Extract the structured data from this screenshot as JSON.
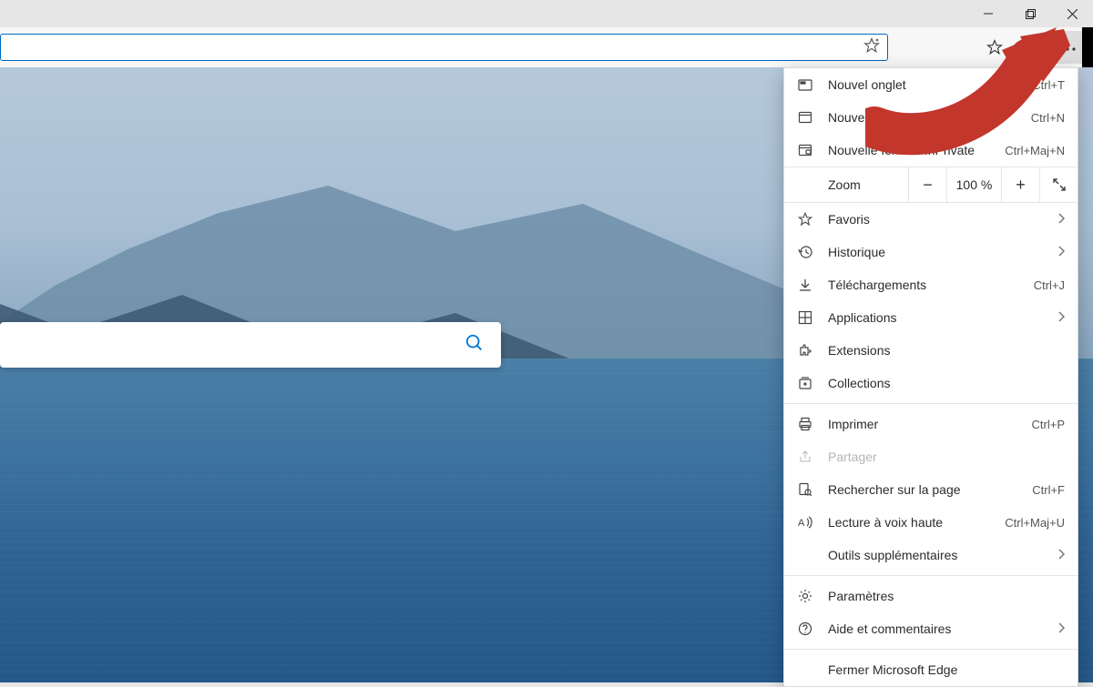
{
  "window_controls": {
    "minimize": "minimize",
    "maximize": "maximize",
    "close": "close"
  },
  "menu": {
    "new_tab": {
      "label": "Nouvel onglet",
      "shortcut": "Ctrl+T"
    },
    "new_window": {
      "label": "Nouvelle fenêtre",
      "shortcut": "Ctrl+N"
    },
    "new_inprivate": {
      "label": "Nouvelle fenêtre InPrivate",
      "shortcut": "Ctrl+Maj+N"
    },
    "zoom": {
      "label": "Zoom",
      "value": "100 %"
    },
    "favorites": {
      "label": "Favoris"
    },
    "history": {
      "label": "Historique"
    },
    "downloads": {
      "label": "Téléchargements",
      "shortcut": "Ctrl+J"
    },
    "apps": {
      "label": "Applications"
    },
    "extensions": {
      "label": "Extensions"
    },
    "collections": {
      "label": "Collections"
    },
    "print": {
      "label": "Imprimer",
      "shortcut": "Ctrl+P"
    },
    "share": {
      "label": "Partager"
    },
    "find": {
      "label": "Rechercher sur la page",
      "shortcut": "Ctrl+F"
    },
    "read_aloud": {
      "label": "Lecture à voix haute",
      "shortcut": "Ctrl+Maj+U"
    },
    "more_tools": {
      "label": "Outils supplémentaires"
    },
    "settings": {
      "label": "Paramètres"
    },
    "help": {
      "label": "Aide et commentaires"
    },
    "close_edge": {
      "label": "Fermer Microsoft Edge"
    }
  },
  "search": {
    "placeholder": ""
  }
}
